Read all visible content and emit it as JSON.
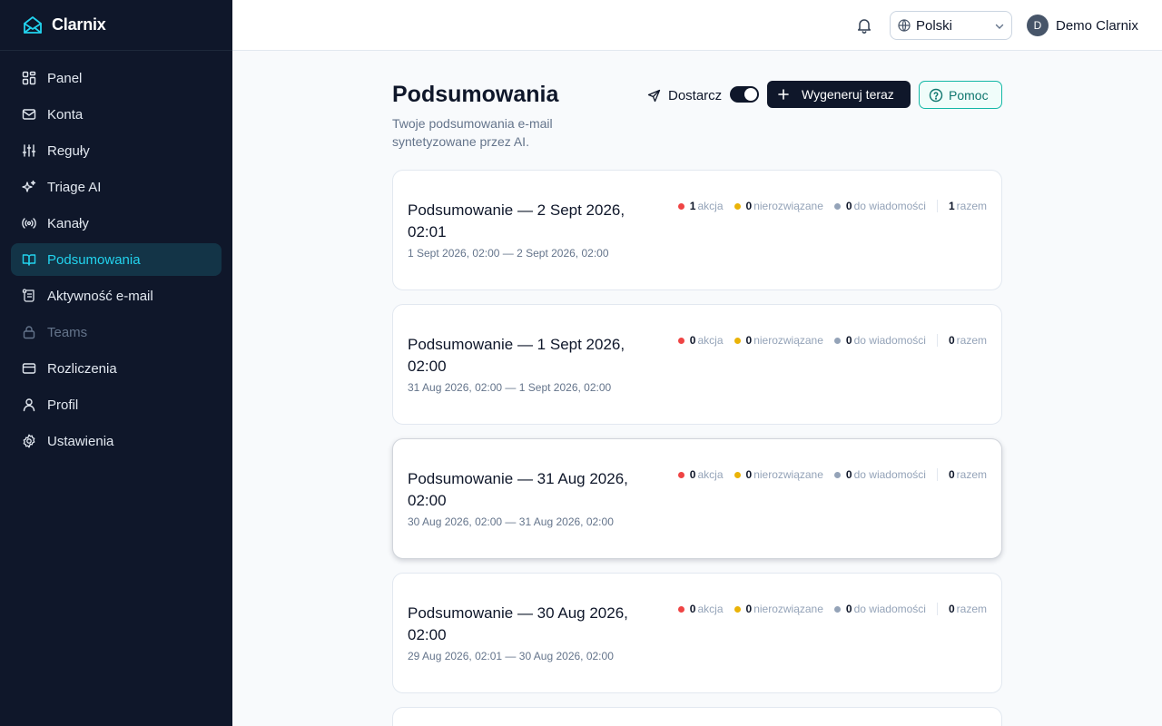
{
  "app": {
    "name": "Clarnix"
  },
  "sidebar": {
    "items": [
      {
        "label": "Panel"
      },
      {
        "label": "Konta"
      },
      {
        "label": "Reguły"
      },
      {
        "label": "Triage AI"
      },
      {
        "label": "Kanały"
      },
      {
        "label": "Podsumowania"
      },
      {
        "label": "Aktywność e-mail"
      },
      {
        "label": "Teams"
      },
      {
        "label": "Rozliczenia"
      },
      {
        "label": "Profil"
      },
      {
        "label": "Ustawienia"
      }
    ],
    "active": "Podsumowania"
  },
  "topbar": {
    "language": "Polski",
    "user_initial": "D",
    "user_name": "Demo Clarnix"
  },
  "header": {
    "title": "Podsumowania",
    "subtitle": "Twoje podsumowania e-mail syntetyzowane przez AI.",
    "deliver_label": "Dostarcz",
    "deliver_enabled": true,
    "generate_label": "Wygeneruj teraz",
    "help_label": "Pomoc"
  },
  "stat_labels": {
    "action": "akcja",
    "unresolved": "nierozwiązane",
    "to_message": "do wiadomości",
    "total": "razem"
  },
  "colors": {
    "action": "#ef4444",
    "unresolved": "#eab308",
    "to_message": "#94a3b8",
    "accent": "#22d3ee"
  },
  "digests": [
    {
      "title": "Podsumowanie — 2 Sept 2026, 02:01",
      "range": "1 Sept 2026, 02:00 — 2 Sept 2026, 02:00",
      "action": "1",
      "unresolved": "0",
      "to_message": "0",
      "total": "1"
    },
    {
      "title": "Podsumowanie — 1 Sept 2026, 02:00",
      "range": "31 Aug 2026, 02:00 — 1 Sept 2026, 02:00",
      "action": "0",
      "unresolved": "0",
      "to_message": "0",
      "total": "0"
    },
    {
      "title": "Podsumowanie — 31 Aug 2026, 02:00",
      "range": "30 Aug 2026, 02:00 — 31 Aug 2026, 02:00",
      "action": "0",
      "unresolved": "0",
      "to_message": "0",
      "total": "0"
    },
    {
      "title": "Podsumowanie — 30 Aug 2026, 02:00",
      "range": "29 Aug 2026, 02:01 — 30 Aug 2026, 02:00",
      "action": "0",
      "unresolved": "0",
      "to_message": "0",
      "total": "0"
    }
  ]
}
